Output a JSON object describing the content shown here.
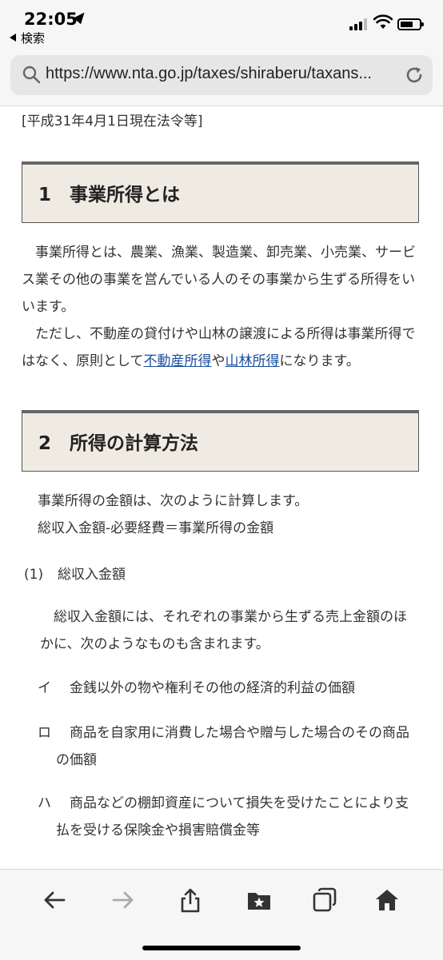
{
  "status_bar": {
    "time": "22:05",
    "back_app_label": "検索"
  },
  "browser": {
    "url": "https://www.nta.go.jp/taxes/shiraberu/taxans..."
  },
  "page": {
    "date_note": "[平成31年4月1日現在法令等]",
    "section1": {
      "heading": "1　事業所得とは",
      "para1": "事業所得とは、農業、漁業、製造業、卸売業、小売業、サービス業その他の事業を営んでいる人のその事業から生ずる所得をいいます。",
      "para2_before": "ただし、不動産の貸付けや山林の譲渡による所得は事業所得ではなく、原則として",
      "link_real_estate": "不動産所得",
      "para2_middle": "や",
      "link_forest": "山林所得",
      "para2_after": "になります。"
    },
    "section2": {
      "heading": "2　所得の計算方法",
      "intro_line1": "事業所得の金額は、次のように計算します。",
      "intro_line2": "総収入金額-必要経費＝事業所得の金額",
      "sub1_number": "(1)",
      "sub1_title": "総収入金額",
      "sub1_para": "総収入金額には、それぞれの事業から生ずる売上金額のほかに、次のようなものも含まれます。",
      "items": [
        {
          "marker": "イ",
          "text": "金銭以外の物や権利その他の経済的利益の価額"
        },
        {
          "marker": "ロ",
          "text": "商品を自家用に消費した場合や贈与した場合のその商品の価額"
        },
        {
          "marker": "ハ",
          "text": "商品などの棚卸資産について損失を受けたことにより支払を受ける保険金や損害賠償金等"
        }
      ]
    }
  },
  "toolbar": {
    "icons": [
      "back-arrow-icon",
      "forward-arrow-icon",
      "share-icon",
      "bookmarks-icon",
      "tabs-icon",
      "home-icon"
    ]
  },
  "colors": {
    "heading_bg": "#efebe3",
    "link": "#1a4fa0",
    "chrome_bg": "#f6f6f6"
  }
}
